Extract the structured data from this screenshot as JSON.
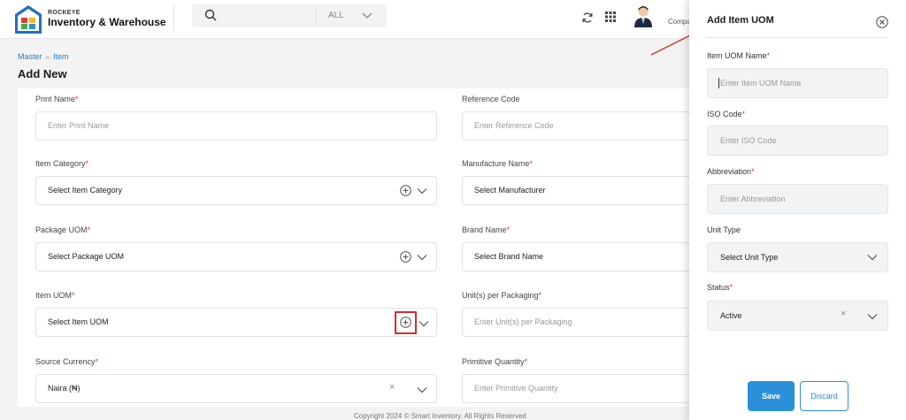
{
  "app": {
    "brand_small": "ROCKEYE",
    "brand_name": "Inventory & Warehouse"
  },
  "search": {
    "scope": "ALL"
  },
  "user": {
    "label": "Compa"
  },
  "breadcrumb": {
    "items": [
      "Master",
      "Item"
    ]
  },
  "page": {
    "title": "Add New"
  },
  "form": {
    "print_name": {
      "label": "Print Name",
      "required": "*",
      "placeholder": "Enter Print Name"
    },
    "reference_code": {
      "label": "Reference Code",
      "placeholder": "Enter Reference Code"
    },
    "item_category": {
      "label": "Item Category",
      "required": "*",
      "value": "Select Item Category"
    },
    "manufacture_name": {
      "label": "Manufacture Name",
      "required": "*",
      "value": "Select Manufacturer"
    },
    "package_uom": {
      "label": "Package UOM",
      "required": "*",
      "value": "Select Package UOM"
    },
    "brand_name": {
      "label": "Brand Name",
      "required": "*",
      "value": "Select Brand Name"
    },
    "item_uom": {
      "label": "Item UOM",
      "required": "*",
      "value": "Select Item UOM"
    },
    "units_per_packaging": {
      "label": "Unit(s) per Packaging",
      "required": "*",
      "placeholder": "Enter Unit(s) per Packaging"
    },
    "source_currency": {
      "label": "Source Currency",
      "required": "*",
      "value": "Naira (₦)",
      "clear": "×"
    },
    "primitive_quantity": {
      "label": "Primitive Quantity",
      "required": "*",
      "placeholder": "Enter Primitive Quantity"
    }
  },
  "footer": {
    "text": "Copyright 2024 © Smart Inventory. All Rights Reserved"
  },
  "drawer": {
    "title": "Add Item UOM",
    "item_uom_name": {
      "label": "Item UOM Name",
      "required": "*",
      "placeholder": "Enter Item UOM Name"
    },
    "iso_code": {
      "label": "ISO Code",
      "required": "*",
      "placeholder": "Enter ISO Code"
    },
    "abbreviation": {
      "label": "Abbreviation",
      "required": "*",
      "placeholder": "Enter Abbreviation"
    },
    "unit_type": {
      "label": "Unit Type",
      "value": "Select Unit Type"
    },
    "status": {
      "label": "Status",
      "required": "*",
      "value": "Active",
      "clear": "×"
    },
    "save_label": "Save",
    "discard_label": "Discard"
  },
  "colors": {
    "accent": "#2a90d9",
    "required": "#e0363a",
    "highlight": "#d62c2c"
  }
}
